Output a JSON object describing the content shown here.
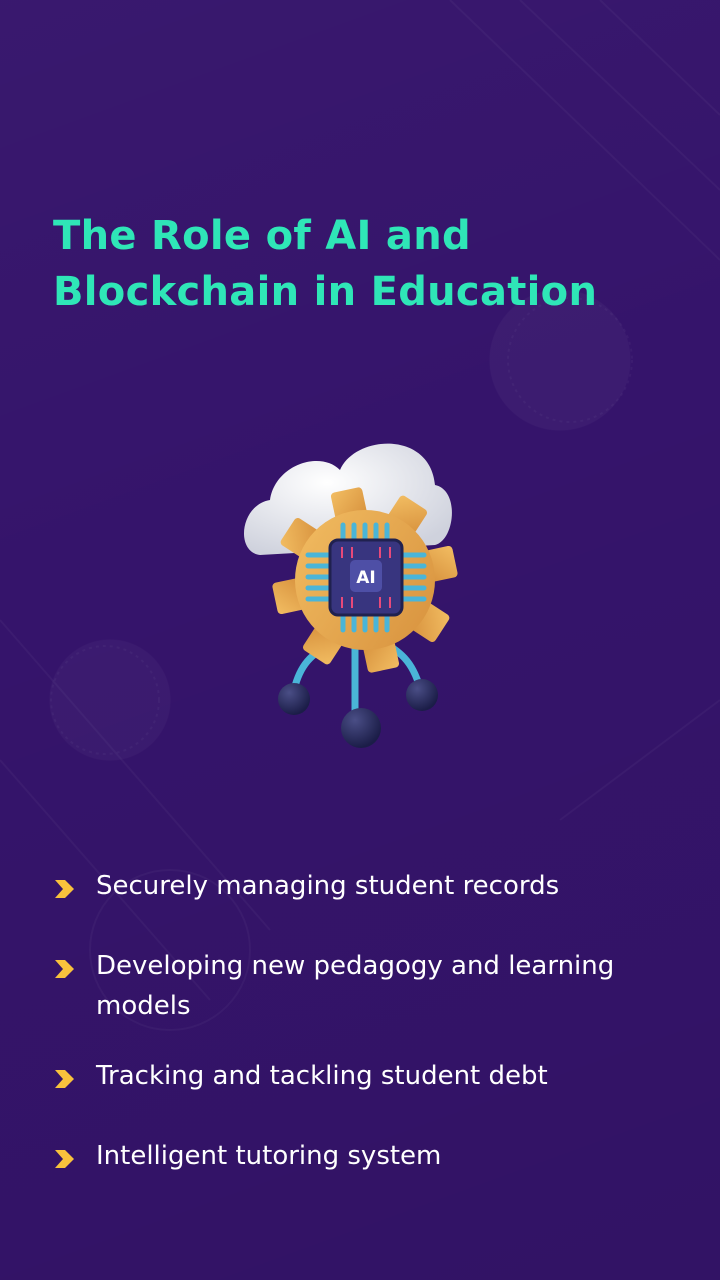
{
  "title": {
    "line1": "The Role of AI and",
    "line2": "Blockchain in Education"
  },
  "illustration": {
    "chip_label": "AI",
    "icons": [
      "cloud-icon",
      "gear-icon",
      "ai-chip-icon",
      "circuit-nodes-icon"
    ]
  },
  "list": {
    "items": [
      {
        "text": "Securely managing student records"
      },
      {
        "text": "Developing new pedagogy and learning models"
      },
      {
        "text": "Tracking and tackling student debt"
      },
      {
        "text": "Intelligent tutoring system"
      }
    ]
  },
  "colors": {
    "background": "#35146b",
    "title": "#2fe6b7",
    "body_text": "#ffffff",
    "bullet": "#f8c23c",
    "gear": "#e6ab4f",
    "cloud": "#eef0f5",
    "circuit": "#4ab5d8",
    "chip": "#38357f",
    "node": "#26295d"
  }
}
